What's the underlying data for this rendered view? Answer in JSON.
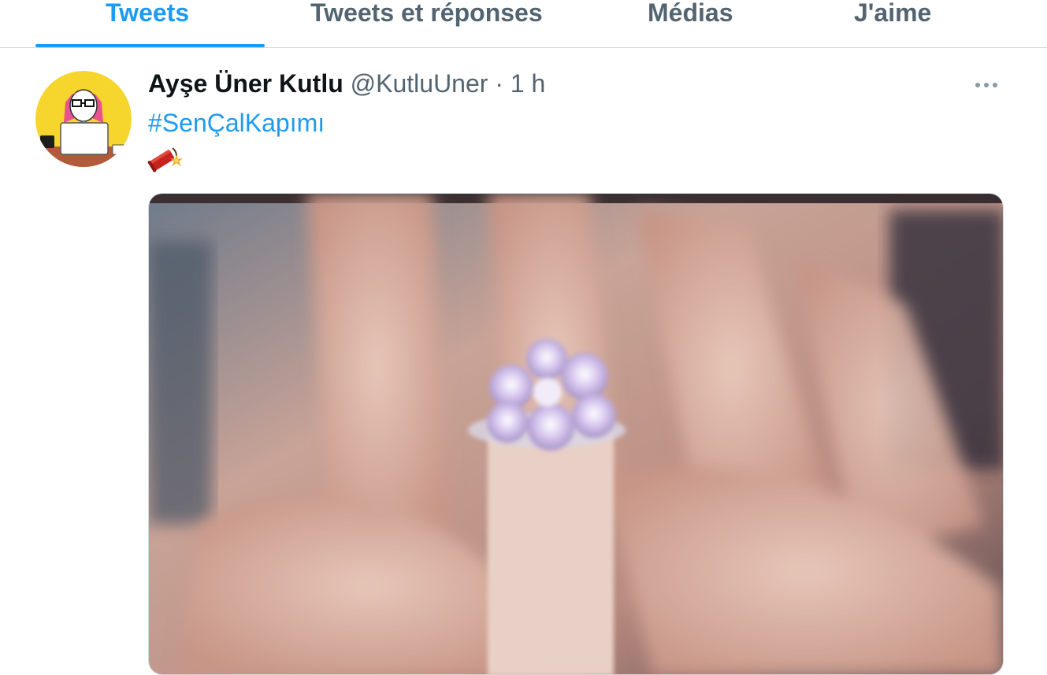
{
  "tabs": [
    {
      "label": "Tweets",
      "active": true
    },
    {
      "label": "Tweets et réponses",
      "active": false
    },
    {
      "label": "Médias",
      "active": false
    },
    {
      "label": "J'aime",
      "active": false
    }
  ],
  "tweet": {
    "display_name": "Ayşe Üner Kutlu",
    "handle": "@KutluUner",
    "separator": "·",
    "time": "1 h",
    "hashtag": "#SenÇalKapımı",
    "emoji": "firecracker",
    "avatar_icon": "cartoon-girl-laptop-avatar",
    "more_icon": "more-horizontal-icon",
    "media_description_icon": "ring-photo"
  },
  "colors": {
    "accent": "#1d9bf0",
    "text_primary": "#0f1419",
    "text_secondary": "#536471",
    "border": "#cfd9de"
  }
}
